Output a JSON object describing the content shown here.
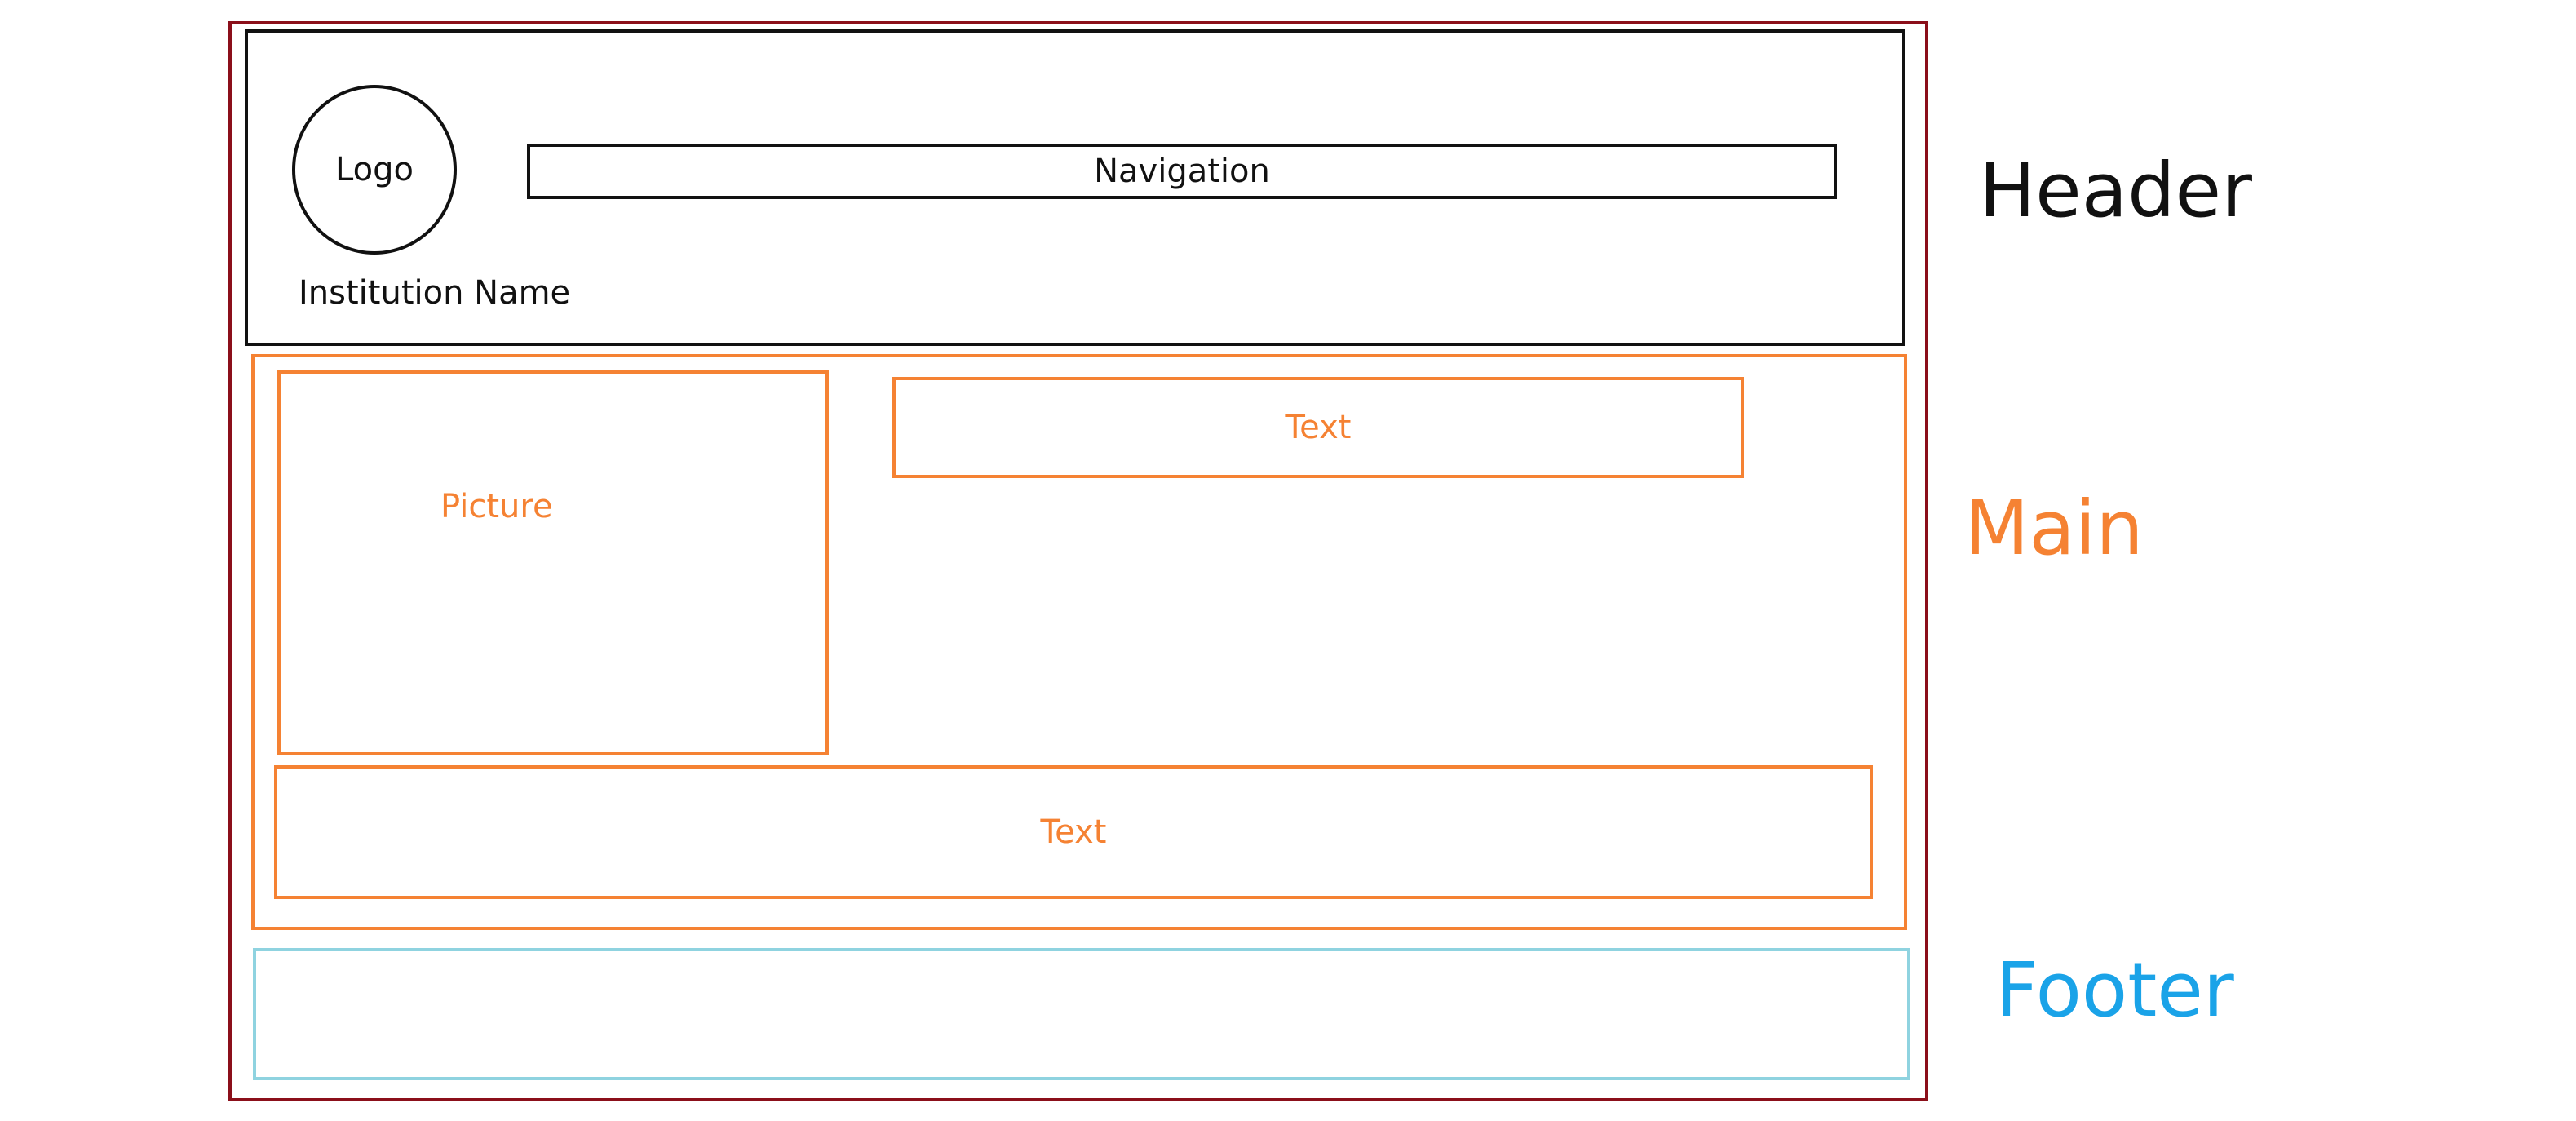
{
  "header": {
    "logo_label": "Logo",
    "navigation_label": "Navigation",
    "institution_name": "Institution Name",
    "region_label": "Header"
  },
  "main": {
    "picture_label": "Picture",
    "text_top_label": "Text",
    "text_bottom_label": "Text",
    "region_label": "Main"
  },
  "footer": {
    "region_label": "Footer"
  },
  "colors": {
    "page_frame": "#8b0f1a",
    "header": "#111111",
    "main": "#f58233",
    "footer_border": "#8fd3e0",
    "footer_label": "#1aa3e8"
  }
}
